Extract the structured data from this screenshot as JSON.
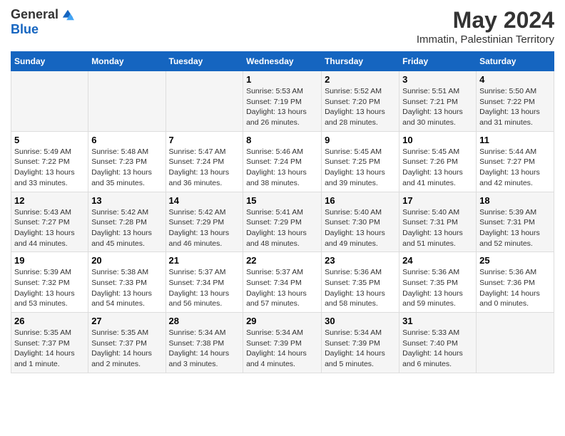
{
  "logo": {
    "general": "General",
    "blue": "Blue"
  },
  "title": "May 2024",
  "subtitle": "Immatin, Palestinian Territory",
  "weekdays": [
    "Sunday",
    "Monday",
    "Tuesday",
    "Wednesday",
    "Thursday",
    "Friday",
    "Saturday"
  ],
  "weeks": [
    [
      {
        "day": "",
        "text": ""
      },
      {
        "day": "",
        "text": ""
      },
      {
        "day": "",
        "text": ""
      },
      {
        "day": "1",
        "text": "Sunrise: 5:53 AM\nSunset: 7:19 PM\nDaylight: 13 hours and 26 minutes."
      },
      {
        "day": "2",
        "text": "Sunrise: 5:52 AM\nSunset: 7:20 PM\nDaylight: 13 hours and 28 minutes."
      },
      {
        "day": "3",
        "text": "Sunrise: 5:51 AM\nSunset: 7:21 PM\nDaylight: 13 hours and 30 minutes."
      },
      {
        "day": "4",
        "text": "Sunrise: 5:50 AM\nSunset: 7:22 PM\nDaylight: 13 hours and 31 minutes."
      }
    ],
    [
      {
        "day": "5",
        "text": "Sunrise: 5:49 AM\nSunset: 7:22 PM\nDaylight: 13 hours and 33 minutes."
      },
      {
        "day": "6",
        "text": "Sunrise: 5:48 AM\nSunset: 7:23 PM\nDaylight: 13 hours and 35 minutes."
      },
      {
        "day": "7",
        "text": "Sunrise: 5:47 AM\nSunset: 7:24 PM\nDaylight: 13 hours and 36 minutes."
      },
      {
        "day": "8",
        "text": "Sunrise: 5:46 AM\nSunset: 7:24 PM\nDaylight: 13 hours and 38 minutes."
      },
      {
        "day": "9",
        "text": "Sunrise: 5:45 AM\nSunset: 7:25 PM\nDaylight: 13 hours and 39 minutes."
      },
      {
        "day": "10",
        "text": "Sunrise: 5:45 AM\nSunset: 7:26 PM\nDaylight: 13 hours and 41 minutes."
      },
      {
        "day": "11",
        "text": "Sunrise: 5:44 AM\nSunset: 7:27 PM\nDaylight: 13 hours and 42 minutes."
      }
    ],
    [
      {
        "day": "12",
        "text": "Sunrise: 5:43 AM\nSunset: 7:27 PM\nDaylight: 13 hours and 44 minutes."
      },
      {
        "day": "13",
        "text": "Sunrise: 5:42 AM\nSunset: 7:28 PM\nDaylight: 13 hours and 45 minutes."
      },
      {
        "day": "14",
        "text": "Sunrise: 5:42 AM\nSunset: 7:29 PM\nDaylight: 13 hours and 46 minutes."
      },
      {
        "day": "15",
        "text": "Sunrise: 5:41 AM\nSunset: 7:29 PM\nDaylight: 13 hours and 48 minutes."
      },
      {
        "day": "16",
        "text": "Sunrise: 5:40 AM\nSunset: 7:30 PM\nDaylight: 13 hours and 49 minutes."
      },
      {
        "day": "17",
        "text": "Sunrise: 5:40 AM\nSunset: 7:31 PM\nDaylight: 13 hours and 51 minutes."
      },
      {
        "day": "18",
        "text": "Sunrise: 5:39 AM\nSunset: 7:31 PM\nDaylight: 13 hours and 52 minutes."
      }
    ],
    [
      {
        "day": "19",
        "text": "Sunrise: 5:39 AM\nSunset: 7:32 PM\nDaylight: 13 hours and 53 minutes."
      },
      {
        "day": "20",
        "text": "Sunrise: 5:38 AM\nSunset: 7:33 PM\nDaylight: 13 hours and 54 minutes."
      },
      {
        "day": "21",
        "text": "Sunrise: 5:37 AM\nSunset: 7:34 PM\nDaylight: 13 hours and 56 minutes."
      },
      {
        "day": "22",
        "text": "Sunrise: 5:37 AM\nSunset: 7:34 PM\nDaylight: 13 hours and 57 minutes."
      },
      {
        "day": "23",
        "text": "Sunrise: 5:36 AM\nSunset: 7:35 PM\nDaylight: 13 hours and 58 minutes."
      },
      {
        "day": "24",
        "text": "Sunrise: 5:36 AM\nSunset: 7:35 PM\nDaylight: 13 hours and 59 minutes."
      },
      {
        "day": "25",
        "text": "Sunrise: 5:36 AM\nSunset: 7:36 PM\nDaylight: 14 hours and 0 minutes."
      }
    ],
    [
      {
        "day": "26",
        "text": "Sunrise: 5:35 AM\nSunset: 7:37 PM\nDaylight: 14 hours and 1 minute."
      },
      {
        "day": "27",
        "text": "Sunrise: 5:35 AM\nSunset: 7:37 PM\nDaylight: 14 hours and 2 minutes."
      },
      {
        "day": "28",
        "text": "Sunrise: 5:34 AM\nSunset: 7:38 PM\nDaylight: 14 hours and 3 minutes."
      },
      {
        "day": "29",
        "text": "Sunrise: 5:34 AM\nSunset: 7:39 PM\nDaylight: 14 hours and 4 minutes."
      },
      {
        "day": "30",
        "text": "Sunrise: 5:34 AM\nSunset: 7:39 PM\nDaylight: 14 hours and 5 minutes."
      },
      {
        "day": "31",
        "text": "Sunrise: 5:33 AM\nSunset: 7:40 PM\nDaylight: 14 hours and 6 minutes."
      },
      {
        "day": "",
        "text": ""
      }
    ]
  ]
}
